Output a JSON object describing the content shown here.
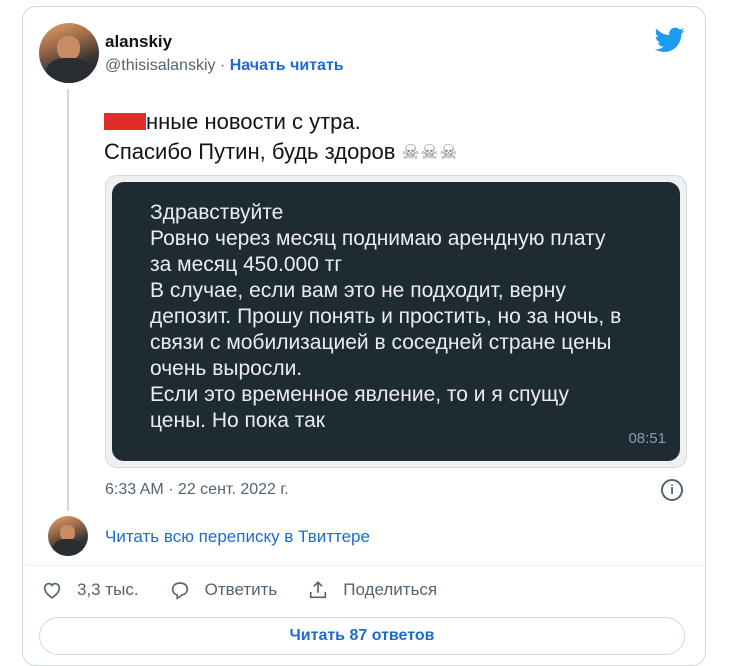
{
  "tweet": {
    "author_name": "alanskiy",
    "handle": "@thisisalanskiy",
    "separator": " · ",
    "follow_label": "Начать читать",
    "text_line1_visible": "нные новости с утра.",
    "text_line2": "Спасибо Путин, будь здоров",
    "skulls": "☠☠☠",
    "timestamp": "6:33 AM · 22 сент. 2022 г.",
    "info_glyph": "i",
    "thread_link": "Читать всю переписку в Твиттере"
  },
  "media": {
    "message_lines": [
      "Здравствуйте",
      "Ровно через месяц поднимаю арендную плату",
      "за месяц 450.000 тг",
      "В случае, если вам это не подходит, верну",
      "депозит. Прошу понять и простить, но за ночь, в",
      "связи с мобилизацией в соседней стране цены",
      "очень выросли.",
      "Если это временное явление, то и я спущу",
      "цены. Но пока так"
    ],
    "time": "08:51"
  },
  "actions": {
    "likes": "3,3 тыс.",
    "reply": "Ответить",
    "share": "Поделиться",
    "read_replies": "Читать 87 ответов"
  },
  "colors": {
    "accent": "#1d6bd0",
    "bird": "#1d9bf0",
    "redaction": "#e22b2b",
    "bubble_bg": "#1f2b33"
  },
  "icons": [
    "twitter-bird-icon",
    "heart-icon",
    "reply-icon",
    "share-icon",
    "info-icon"
  ]
}
